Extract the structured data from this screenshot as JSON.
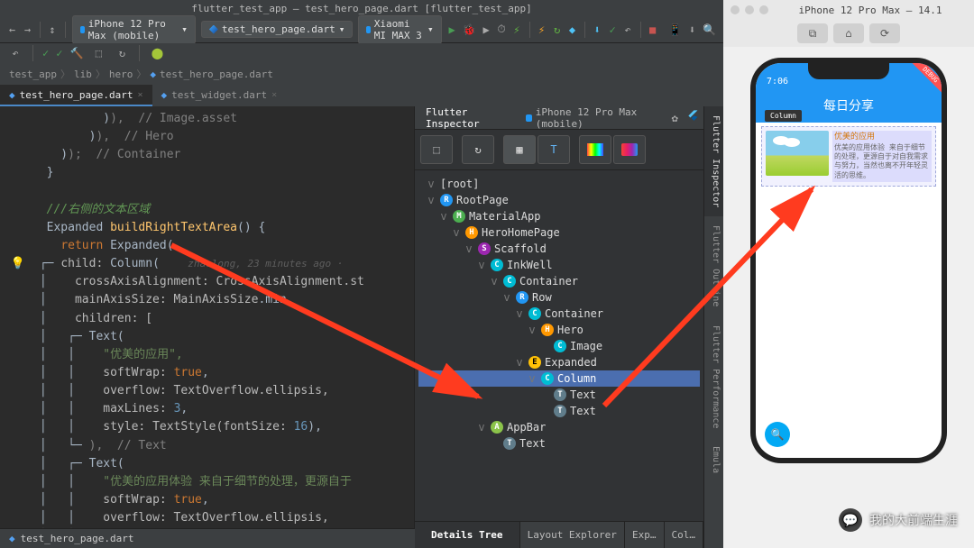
{
  "ide": {
    "title": "flutter_test_app – test_hero_page.dart [flutter_test_app]",
    "device_dd": "iPhone 12 Pro Max (mobile)",
    "run_config_dd": "test_hero_page.dart",
    "target_dd": "Xiaomi MI MAX 3",
    "breadcrumb": [
      "test_app",
      "lib",
      "hero",
      "test_hero_page.dart"
    ],
    "editor_tabs": [
      {
        "label": "test_hero_page.dart",
        "active": true
      },
      {
        "label": "test_widget.dart",
        "active": false
      }
    ],
    "bottom_tab": "test_hero_page.dart",
    "code": {
      "close1": "),  // Image.asset",
      "close2": "),  // Hero",
      "close3": ");  // Container",
      "brace": "}",
      "doc": "///右侧的文本区域",
      "sig1a": "Expanded ",
      "sig1b": "buildRightTextArea",
      "sig1c": "() {",
      "ret": "return ",
      "retb": "Expanded(",
      "childa": "child: ",
      "childb": "Column(",
      "blame": "zhaolong, 23 minutes ago ·",
      "caa": "crossAxisAlignment: CrossAxisAlignment.st",
      "masa": "mainAxisSize: MainAxisSize",
      "masb": ".min,",
      "children": "children: [",
      "text": "Text(",
      "str1": "\"优美的应用\",",
      "soft": "softWrap: ",
      "true": "true",
      "comma": ",",
      "ovf": "overflow: TextOverflow.ellipsis,",
      "max3": "maxLines: ",
      "three": "3",
      "style": "style: TextStyle(fontSize: ",
      "sixteen": "16",
      "styleEnd": "),",
      "closeText": "),  // Text",
      "str2": "\"优美的应用体验 来自于细节的处理，更源自于"
    }
  },
  "inspector": {
    "tabs": [
      "Flutter Inspector",
      "iPhone 12 Pro Max (mobile)"
    ],
    "tree": [
      {
        "depth": 0,
        "icon": "",
        "label": "[root]",
        "twist": "v"
      },
      {
        "depth": 0,
        "icon": "R",
        "cls": "ic-r",
        "label": "RootPage",
        "twist": "v"
      },
      {
        "depth": 1,
        "icon": "M",
        "cls": "ic-m",
        "label": "MaterialApp",
        "twist": "v"
      },
      {
        "depth": 2,
        "icon": "H",
        "cls": "ic-h",
        "label": "HeroHomePage",
        "twist": "v"
      },
      {
        "depth": 3,
        "icon": "S",
        "cls": "ic-s",
        "label": "Scaffold",
        "twist": "v"
      },
      {
        "depth": 4,
        "icon": "C",
        "cls": "ic-c",
        "label": "InkWell",
        "twist": "v"
      },
      {
        "depth": 5,
        "icon": "C",
        "cls": "ic-c",
        "label": "Container",
        "twist": "v"
      },
      {
        "depth": 6,
        "icon": "R",
        "cls": "ic-r",
        "label": "Row",
        "twist": "v"
      },
      {
        "depth": 7,
        "icon": "C",
        "cls": "ic-c",
        "label": "Container",
        "twist": "v"
      },
      {
        "depth": 8,
        "icon": "H",
        "cls": "ic-h",
        "label": "Hero",
        "twist": "v"
      },
      {
        "depth": 9,
        "icon": "C",
        "cls": "ic-c",
        "label": "Image",
        "twist": ""
      },
      {
        "depth": 7,
        "icon": "E",
        "cls": "ic-e",
        "label": "Expanded",
        "twist": "v"
      },
      {
        "depth": 8,
        "icon": "C",
        "cls": "ic-c",
        "label": "Column",
        "twist": "v",
        "sel": true
      },
      {
        "depth": 9,
        "icon": "T",
        "cls": "ic-t",
        "label": "Text",
        "twist": ""
      },
      {
        "depth": 9,
        "icon": "T",
        "cls": "ic-t",
        "label": "Text",
        "twist": ""
      },
      {
        "depth": 4,
        "icon": "A",
        "cls": "ic-a",
        "label": "AppBar",
        "twist": "v"
      },
      {
        "depth": 5,
        "icon": "T",
        "cls": "ic-t",
        "label": "Text",
        "twist": ""
      }
    ],
    "bottom_tabs": {
      "details": "Details Tree",
      "layout": "Layout Explorer",
      "exp": "Exp…",
      "col": "Col…"
    },
    "rail": [
      "Flutter Inspector",
      "Flutter Outline",
      "Flutter Performance",
      "Emula"
    ]
  },
  "sim": {
    "title": "iPhone 12 Pro Max – 14.1",
    "time": "7:06",
    "appbar_title": "每日分享",
    "tooltip": "Column",
    "debug": "DEBUG",
    "card_title": "优美的应用",
    "card_body": "优美的应用体验 来自于细节的处理，更源自于对自我需求与努力，当然也离不开年轻灵活的思维。"
  },
  "watermark": "我的大前端生涯"
}
